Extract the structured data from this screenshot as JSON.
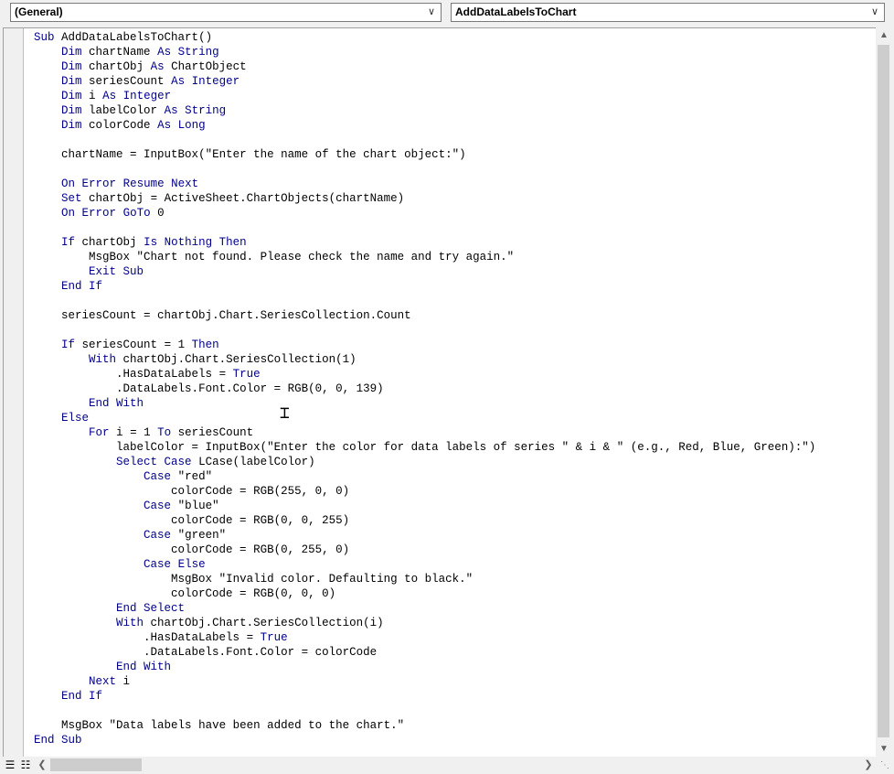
{
  "toolbar": {
    "object_combo": {
      "value": "(General)",
      "arrow_icon": "chevron-down-icon"
    },
    "procedure_combo": {
      "value": "AddDataLabelsToChart",
      "arrow_icon": "chevron-down-icon"
    }
  },
  "editor": {
    "colors": {
      "keyword": "#00008b",
      "text": "#000000",
      "background": "#ffffff"
    },
    "code_lines": [
      {
        "text": "Sub AddDataLabelsToChart()"
      },
      {
        "text": "    Dim chartName As String"
      },
      {
        "text": "    Dim chartObj As ChartObject"
      },
      {
        "text": "    Dim seriesCount As Integer"
      },
      {
        "text": "    Dim i As Integer"
      },
      {
        "text": "    Dim labelColor As String"
      },
      {
        "text": "    Dim colorCode As Long"
      },
      {
        "text": ""
      },
      {
        "text": "    chartName = InputBox(\"Enter the name of the chart object:\")"
      },
      {
        "text": ""
      },
      {
        "text": "    On Error Resume Next"
      },
      {
        "text": "    Set chartObj = ActiveSheet.ChartObjects(chartName)"
      },
      {
        "text": "    On Error GoTo 0"
      },
      {
        "text": ""
      },
      {
        "text": "    If chartObj Is Nothing Then"
      },
      {
        "text": "        MsgBox \"Chart not found. Please check the name and try again.\""
      },
      {
        "text": "        Exit Sub"
      },
      {
        "text": "    End If"
      },
      {
        "text": ""
      },
      {
        "text": "    seriesCount = chartObj.Chart.SeriesCollection.Count"
      },
      {
        "text": ""
      },
      {
        "text": "    If seriesCount = 1 Then"
      },
      {
        "text": "        With chartObj.Chart.SeriesCollection(1)"
      },
      {
        "text": "            .HasDataLabels = True"
      },
      {
        "text": "            .DataLabels.Font.Color = RGB(0, 0, 139)"
      },
      {
        "text": "        End With"
      },
      {
        "text": "    Else"
      },
      {
        "text": "        For i = 1 To seriesCount"
      },
      {
        "text": "            labelColor = InputBox(\"Enter the color for data labels of series \" & i & \" (e.g., Red, Blue, Green):\")"
      },
      {
        "text": "            Select Case LCase(labelColor)"
      },
      {
        "text": "                Case \"red\""
      },
      {
        "text": "                    colorCode = RGB(255, 0, 0)"
      },
      {
        "text": "                Case \"blue\""
      },
      {
        "text": "                    colorCode = RGB(0, 0, 255)"
      },
      {
        "text": "                Case \"green\""
      },
      {
        "text": "                    colorCode = RGB(0, 255, 0)"
      },
      {
        "text": "                Case Else"
      },
      {
        "text": "                    MsgBox \"Invalid color. Defaulting to black.\""
      },
      {
        "text": "                    colorCode = RGB(0, 0, 0)"
      },
      {
        "text": "            End Select"
      },
      {
        "text": "            With chartObj.Chart.SeriesCollection(i)"
      },
      {
        "text": "                .HasDataLabels = True"
      },
      {
        "text": "                .DataLabels.Font.Color = colorCode"
      },
      {
        "text": "            End With"
      },
      {
        "text": "        Next i"
      },
      {
        "text": "    End If"
      },
      {
        "text": ""
      },
      {
        "text": "    MsgBox \"Data labels have been added to the chart.\""
      },
      {
        "text": "End Sub"
      }
    ],
    "keywords": [
      "Sub",
      "End",
      "Dim",
      "As",
      "String",
      "Integer",
      "Long",
      "On",
      "Error",
      "Resume",
      "Next",
      "Set",
      "GoTo",
      "If",
      "Is",
      "Nothing",
      "Then",
      "Exit",
      "With",
      "True",
      "Else",
      "For",
      "To",
      "Select",
      "Case"
    ]
  },
  "icons": {
    "cursor": "text-cursor-icon",
    "procedure_view": "procedure-view-icon",
    "module_view": "full-module-view-icon",
    "scroll_up": "scroll-up-arrow-icon",
    "scroll_down": "scroll-down-arrow-icon",
    "scroll_left": "scroll-left-arrow-icon",
    "scroll_right": "scroll-right-arrow-icon",
    "resize_grip": "resize-grip-icon"
  }
}
